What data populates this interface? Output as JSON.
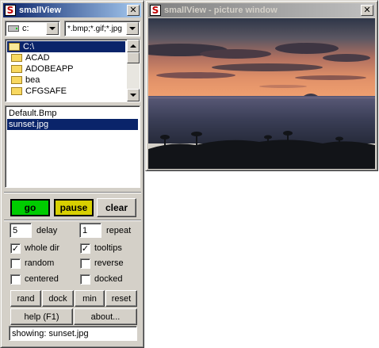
{
  "main_window": {
    "title": "smallView",
    "app_icon_glyph": "S",
    "close_glyph": "✕",
    "drive_combo": {
      "value": "c:"
    },
    "filter_combo": {
      "value": "*.bmp;*.gif;*.jpg"
    },
    "folders": [
      {
        "label": "C:\\",
        "selected": true
      },
      {
        "label": "ACAD",
        "selected": false
      },
      {
        "label": "ADOBEAPP",
        "selected": false
      },
      {
        "label": "bea",
        "selected": false
      },
      {
        "label": "CFGSAFE",
        "selected": false
      }
    ],
    "files": [
      {
        "label": "Default.Bmp",
        "selected": false
      },
      {
        "label": "sunset.jpg",
        "selected": true
      }
    ],
    "controls": {
      "go_label": "go",
      "pause_label": "pause",
      "clear_label": "clear",
      "delay_value": "5",
      "delay_label": "delay",
      "repeat_value": "1",
      "repeat_label": "repeat",
      "whole_dir_label": "whole dir",
      "whole_dir_checked": true,
      "tooltips_label": "tooltips",
      "tooltips_checked": true,
      "random_label": "random",
      "random_checked": false,
      "reverse_label": "reverse",
      "reverse_checked": false,
      "centered_label": "centered",
      "centered_checked": false,
      "docked_label": "docked",
      "docked_checked": false,
      "rand_label": "rand",
      "dock_label": "dock",
      "min_label": "min",
      "reset_label": "reset",
      "help_label": "help (F1)",
      "about_label": "about...",
      "status_text": "showing: sunset.jpg"
    }
  },
  "picture_window": {
    "title": "smallView - picture window",
    "app_icon_glyph": "S",
    "close_glyph": "✕"
  },
  "colors": {
    "go_button": "#00cc00",
    "pause_button": "#d8d000",
    "active_title": "#0a246a",
    "inactive_title": "#808080",
    "selection": "#0a246a"
  },
  "icons": {
    "drive": "hard-drive-icon",
    "folder": "folder-icon",
    "app": "smallview-app-icon",
    "close": "close-icon"
  }
}
